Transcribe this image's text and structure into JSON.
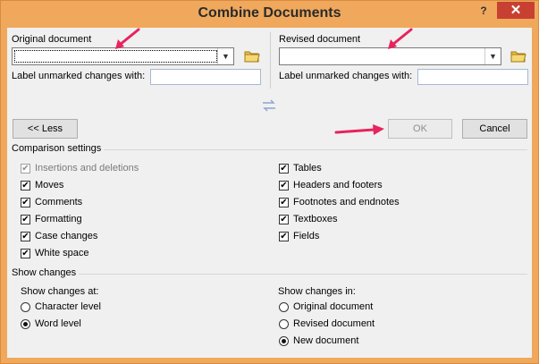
{
  "window": {
    "title": "Combine Documents",
    "help": "?",
    "close": "✕"
  },
  "original": {
    "label": "Original document",
    "label_unmarked": "Label unmarked changes with:"
  },
  "revised": {
    "label": "Revised document",
    "label_unmarked": "Label unmarked changes with:"
  },
  "buttons": {
    "less": "<< Less",
    "ok": "OK",
    "cancel": "Cancel"
  },
  "comparison": {
    "title": "Comparison settings",
    "left": [
      {
        "label": "Insertions and deletions",
        "checked": true,
        "disabled": true
      },
      {
        "label": "Moves",
        "checked": true,
        "disabled": false
      },
      {
        "label": "Comments",
        "checked": true,
        "disabled": false
      },
      {
        "label": "Formatting",
        "checked": true,
        "disabled": false
      },
      {
        "label": "Case changes",
        "checked": true,
        "disabled": false
      },
      {
        "label": "White space",
        "checked": true,
        "disabled": false
      }
    ],
    "right": [
      {
        "label": "Tables",
        "checked": true
      },
      {
        "label": "Headers and footers",
        "checked": true
      },
      {
        "label": "Footnotes and endnotes",
        "checked": true
      },
      {
        "label": "Textboxes",
        "checked": true
      },
      {
        "label": "Fields",
        "checked": true
      }
    ]
  },
  "show_changes": {
    "title": "Show changes",
    "at_label": "Show changes at:",
    "at_options": [
      {
        "label": "Character level",
        "selected": false
      },
      {
        "label": "Word level",
        "selected": true
      }
    ],
    "in_label": "Show changes in:",
    "in_options": [
      {
        "label": "Original document",
        "selected": false
      },
      {
        "label": "Revised document",
        "selected": false
      },
      {
        "label": "New document",
        "selected": true
      }
    ]
  },
  "colors": {
    "annotation_arrow": "#e6245e",
    "title_bar": "#f0a85c",
    "close_button": "#c84031"
  }
}
